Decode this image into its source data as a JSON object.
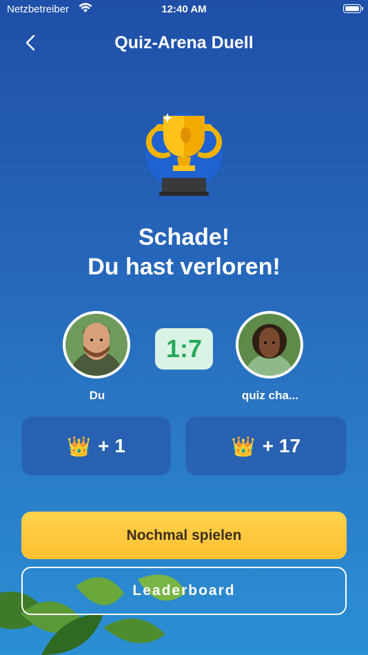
{
  "status_bar": {
    "carrier": "Netzbetreiber",
    "time": "12:40 AM"
  },
  "header": {
    "title": "Quiz-Arena Duell"
  },
  "result": {
    "line1": "Schade!",
    "line2": "Du hast verloren!"
  },
  "players": {
    "left": {
      "name": "Du"
    },
    "right": {
      "name": "quiz cha..."
    }
  },
  "score": "1:7",
  "rewards": {
    "left": {
      "crown": "👑",
      "amount": "+ 1"
    },
    "right": {
      "crown": "👑",
      "amount": "+ 17"
    }
  },
  "buttons": {
    "play_again": "Nochmal spielen",
    "leaderboard": "Leaderboard"
  },
  "colors": {
    "accent_yellow": "#ffc131",
    "score_green": "#27a858",
    "background_blue": "#2563b8"
  },
  "icons": [
    "wifi-icon",
    "battery-icon",
    "back-chevron-icon",
    "trophy-icon",
    "crown-icon"
  ]
}
